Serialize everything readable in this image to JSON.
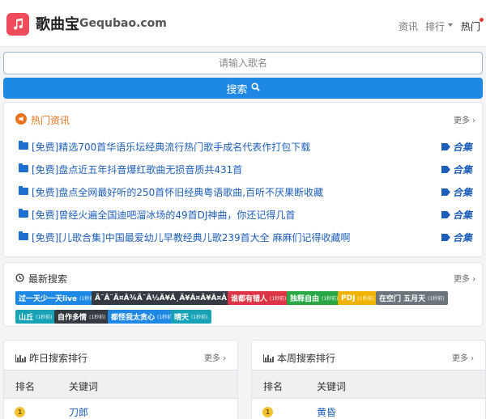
{
  "header": {
    "brand_cn": "歌曲宝",
    "brand_en": "Gequbao.com",
    "nav": [
      {
        "label": "资讯"
      },
      {
        "label": "排行"
      },
      {
        "label": "热门"
      }
    ]
  },
  "search": {
    "placeholder": "请输入歌名",
    "button_label": "搜索"
  },
  "hot_news": {
    "title": "热门资讯",
    "more": "更多 ›",
    "items": [
      {
        "title": "[免费]精选700首华语乐坛经典流行热门歌手成名代表作打包下载",
        "action": "合集"
      },
      {
        "title": "[免费]盘点近五年抖音爆红歌曲无损音质共431首",
        "action": "合集"
      },
      {
        "title": "[免费]盘点全网最好听的250首怀旧经典粤语歌曲,百听不厌果断收藏",
        "action": "合集"
      },
      {
        "title": "[免费]曾经火遍全国迪吧溜冰场的49首DJ神曲，你还记得几首",
        "action": "合集"
      },
      {
        "title": "[免费][儿歌合集]中国最爱幼儿早教经典儿歌239首大全 麻麻们记得收藏啊",
        "action": "合集"
      }
    ]
  },
  "recent_search": {
    "title": "最新搜索",
    "more": "更多 ›",
    "tags": [
      {
        "text": "过一天少一天live",
        "time": "1秒前",
        "color": "#1e88e5"
      },
      {
        "text": "Ã¯Â¨Ã¤Â¾Ã¯Â½Ã¥Â¸Ã¥Â¤Ã¥Â¤Ã¨Â¤Ã¥Â¤",
        "time": "1秒前",
        "color": "#343a40"
      },
      {
        "text": "谁都有错人",
        "time": "1秒前",
        "color": "#dc3545"
      },
      {
        "text": "独释自由",
        "time": "1秒前",
        "color": "#28a745"
      },
      {
        "text": "PDJ",
        "time": "1秒前",
        "color": "#f0b400"
      },
      {
        "text": "在空门 五月天",
        "time": "1秒前",
        "color": "#6c757d"
      },
      {
        "text": "山丘",
        "time": "1秒前",
        "color": "#17a2b8"
      },
      {
        "text": "自作多情",
        "time": "1秒前",
        "color": "#343a40"
      },
      {
        "text": "都怪我太贪心",
        "time": "1秒前",
        "color": "#1e88e5"
      },
      {
        "text": "晴天",
        "time": "1秒前",
        "color": "#17a2b8"
      }
    ]
  },
  "yesterday_rank": {
    "title": "昨日搜索排行",
    "more": "更多 ›",
    "col_rank": "排名",
    "col_keyword": "关键词",
    "rows": [
      {
        "rank": "1",
        "keyword": "刀郎"
      }
    ]
  },
  "week_rank": {
    "title": "本周搜索排行",
    "more": "更多 ›",
    "col_rank": "排名",
    "col_keyword": "关键词",
    "rows": [
      {
        "rank": "1",
        "keyword": "黄昏"
      }
    ]
  },
  "colors": {
    "brand": "#ef4b5a",
    "primary": "#1e88e5",
    "hot_title": "#e8731c",
    "link": "#1d5ebb",
    "rank_badge": "#f2c230"
  },
  "icons": [
    "music-note-icon",
    "fire-icon",
    "folder-icon",
    "tag-icon",
    "history-icon",
    "bar-chart-icon",
    "search-icon"
  ]
}
